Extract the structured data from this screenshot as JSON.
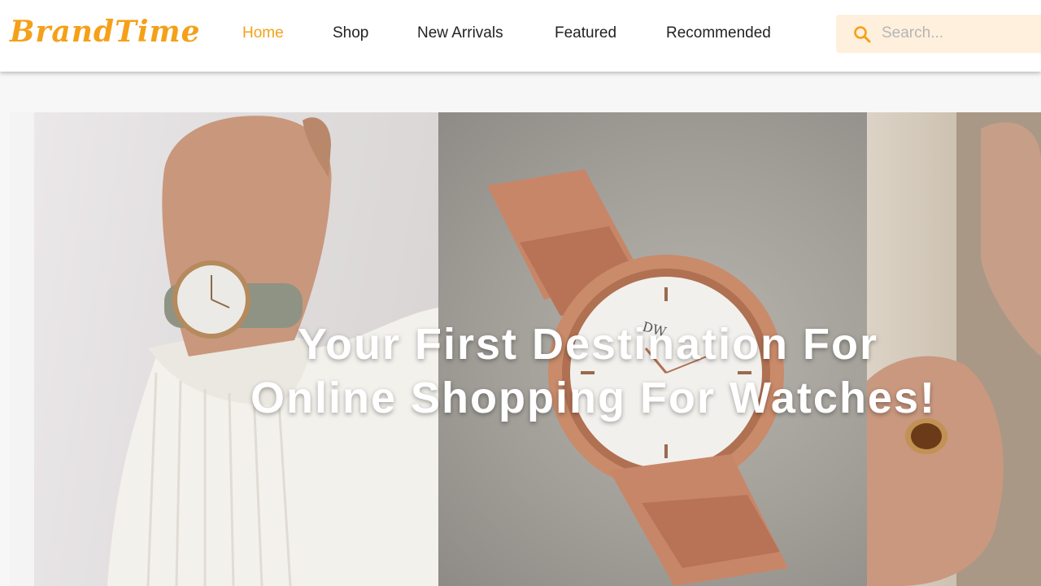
{
  "brand": {
    "name": "BrandTime"
  },
  "nav": {
    "items": [
      {
        "label": "Home",
        "active": true
      },
      {
        "label": "Shop",
        "active": false
      },
      {
        "label": "New Arrivals",
        "active": false
      },
      {
        "label": "Featured",
        "active": false
      },
      {
        "label": "Recommended",
        "active": false
      }
    ]
  },
  "search": {
    "placeholder": "Search...",
    "value": "",
    "icon": "search-icon"
  },
  "hero": {
    "line1": "Your First Destination For",
    "line2": "Online Shopping For Watches!"
  },
  "colors": {
    "accent": "#f5a019",
    "search_bg": "#fef0dc",
    "header_bg": "#ffffff",
    "page_bg": "#f7f7f7"
  }
}
